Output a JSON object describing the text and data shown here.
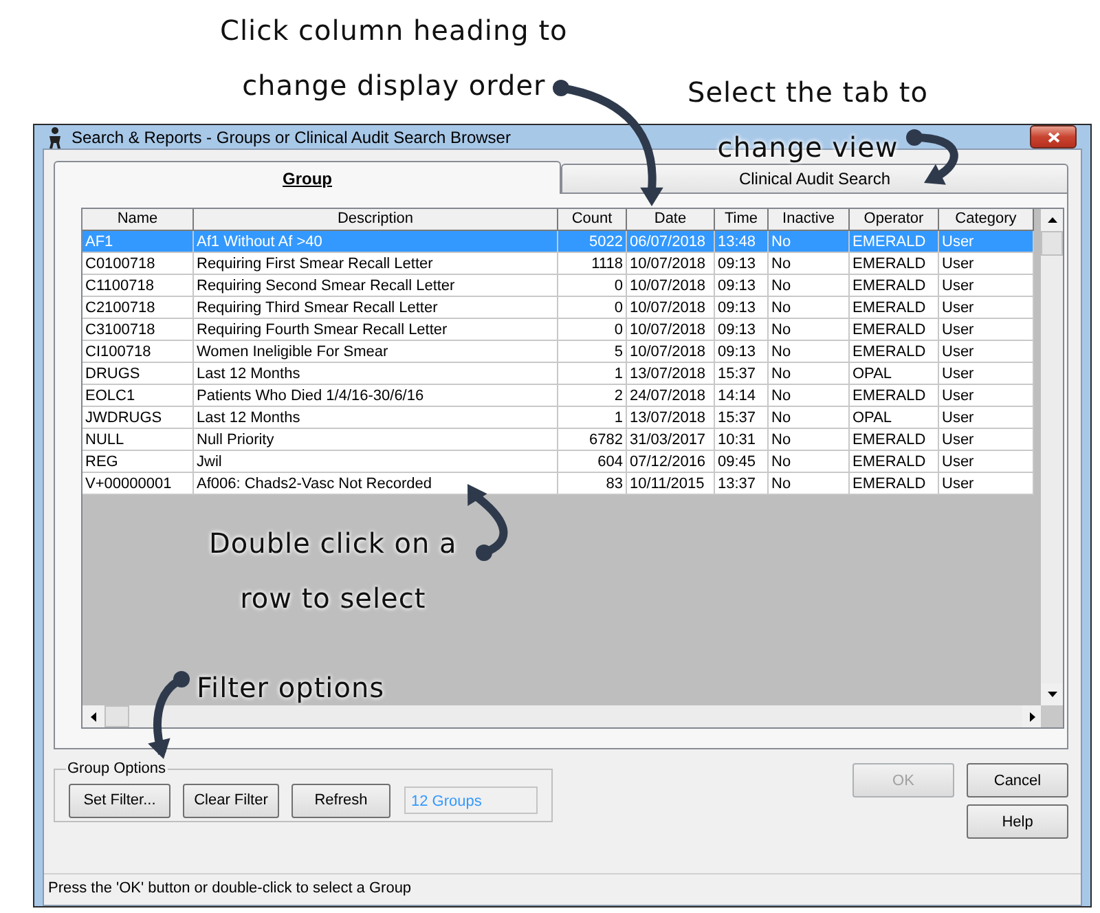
{
  "annotations": [
    {
      "lines": [
        "Click column heading to",
        "change display order"
      ]
    },
    {
      "lines": [
        "Select the tab to",
        "change view"
      ]
    },
    {
      "lines": [
        "Double click on a",
        "row to select"
      ]
    },
    {
      "lines": [
        "Filter options"
      ]
    }
  ],
  "window": {
    "title": "Search & Reports - Groups or Clinical Audit Search Browser"
  },
  "tabs": [
    {
      "label": "Group",
      "selected": true
    },
    {
      "label": "Clinical Audit Search",
      "selected": false
    }
  ],
  "table": {
    "columns": [
      {
        "label": "Name",
        "kind": "text"
      },
      {
        "label": "Description",
        "kind": "text"
      },
      {
        "label": "Count",
        "kind": "number"
      },
      {
        "label": "Date",
        "kind": "text"
      },
      {
        "label": "Time",
        "kind": "text"
      },
      {
        "label": "Inactive",
        "kind": "text"
      },
      {
        "label": "Operator",
        "kind": "text"
      },
      {
        "label": "Category",
        "kind": "text"
      }
    ],
    "rows": [
      {
        "selected": true,
        "cells": [
          "AF1",
          "Af1 Without Af >40",
          "5022",
          "06/07/2018",
          "13:48",
          "No",
          "EMERALD",
          "User"
        ]
      },
      {
        "selected": false,
        "cells": [
          "C0100718",
          "Requiring First Smear Recall Letter",
          "1118",
          "10/07/2018",
          "09:13",
          "No",
          "EMERALD",
          "User"
        ]
      },
      {
        "selected": false,
        "cells": [
          "C1100718",
          "Requiring Second Smear Recall Letter",
          "0",
          "10/07/2018",
          "09:13",
          "No",
          "EMERALD",
          "User"
        ]
      },
      {
        "selected": false,
        "cells": [
          "C2100718",
          "Requiring Third Smear Recall Letter",
          "0",
          "10/07/2018",
          "09:13",
          "No",
          "EMERALD",
          "User"
        ]
      },
      {
        "selected": false,
        "cells": [
          "C3100718",
          "Requiring Fourth Smear Recall Letter",
          "0",
          "10/07/2018",
          "09:13",
          "No",
          "EMERALD",
          "User"
        ]
      },
      {
        "selected": false,
        "cells": [
          "CI100718",
          "Women Ineligible For Smear",
          "5",
          "10/07/2018",
          "09:13",
          "No",
          "EMERALD",
          "User"
        ]
      },
      {
        "selected": false,
        "cells": [
          "DRUGS",
          "Last 12 Months",
          "1",
          "13/07/2018",
          "15:37",
          "No",
          "OPAL",
          "User"
        ]
      },
      {
        "selected": false,
        "cells": [
          "EOLC1",
          "Patients Who Died 1/4/16-30/6/16",
          "2",
          "24/07/2018",
          "14:14",
          "No",
          "EMERALD",
          "User"
        ]
      },
      {
        "selected": false,
        "cells": [
          "JWDRUGS",
          "Last 12 Months",
          "1",
          "13/07/2018",
          "15:37",
          "No",
          "OPAL",
          "User"
        ]
      },
      {
        "selected": false,
        "cells": [
          "NULL",
          "Null Priority",
          "6782",
          "31/03/2017",
          "10:31",
          "No",
          "EMERALD",
          "User"
        ]
      },
      {
        "selected": false,
        "cells": [
          "REG",
          "Jwil",
          "604",
          "07/12/2016",
          "09:45",
          "No",
          "EMERALD",
          "User"
        ]
      },
      {
        "selected": false,
        "cells": [
          "V+00000001",
          "Af006: Chads2-Vasc Not Recorded",
          "83",
          "10/11/2015",
          "13:37",
          "No",
          "EMERALD",
          "User"
        ]
      }
    ]
  },
  "group_options": {
    "legend": "Group Options",
    "buttons": [
      "Set Filter...",
      "Clear Filter",
      "Refresh"
    ],
    "count": "12 Groups"
  },
  "dialog_buttons": [
    {
      "label": "OK",
      "disabled": true
    },
    {
      "label": "Cancel",
      "disabled": false
    },
    {
      "label": "Help",
      "disabled": false
    }
  ],
  "status_bar": "Press the 'OK' button or double-click to select a Group"
}
